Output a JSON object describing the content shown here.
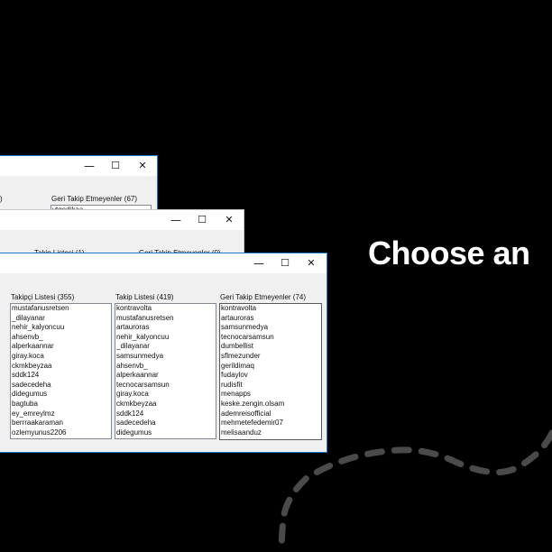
{
  "headline": "Choose an",
  "colors": {
    "background": "#000000",
    "window": "#f0f0f0",
    "accent_border": "#1979ca"
  },
  "icons": {
    "minimize": "minimize-icon",
    "maximize": "maximize-icon",
    "close": "close-icon"
  },
  "window_back": {
    "label": "Geri Takip Etmeyenler (67)",
    "partial_label": ")",
    "partial_item": "ytgedikaa"
  },
  "window_middle": {
    "label_left": "Takip Listesi (1)",
    "label_right": "Geri Takip Etmeyenler (0)"
  },
  "window_front": {
    "followers": {
      "label": "Takipçi Listesi (355)",
      "items": [
        "mustafanusretsen",
        "_dilayanar",
        "nehir_kalyoncuu",
        "ahsenvb_",
        "alperkaannar",
        "giray.koca",
        "ckmkbeyzaa",
        "sddk124",
        "sadecedeha",
        "didegumus",
        "bagtuba",
        "ey_emreylmz",
        "berrraakaraman",
        "ozlemyunus2206"
      ]
    },
    "following": {
      "label": "Takip Listesi (419)",
      "items": [
        "kontravolta",
        "mustafanusretsen",
        "artauroras",
        "nehir_kalyoncuu",
        "_dilayanar",
        "samsunmedya",
        "ahsenvb_",
        "alperkaannar",
        "tecnocarsamsun",
        "giray.koca",
        "ckmkbeyzaa",
        "sddk124",
        "sadecedeha",
        "didegumus"
      ]
    },
    "not_following_back": {
      "label": "Geri Takip Etmeyenler (74)",
      "items": [
        "kontravolta",
        "artauroras",
        "samsunmedya",
        "tecnocarsamsun",
        "dumbellist",
        "sflmezunder",
        "gerildimaq",
        "fudaylov",
        "rudisfit",
        "menapps",
        "keske.zengin.olsam",
        "ademreisofficial",
        "mehmetefedemir07",
        "melisaanduz"
      ]
    }
  }
}
